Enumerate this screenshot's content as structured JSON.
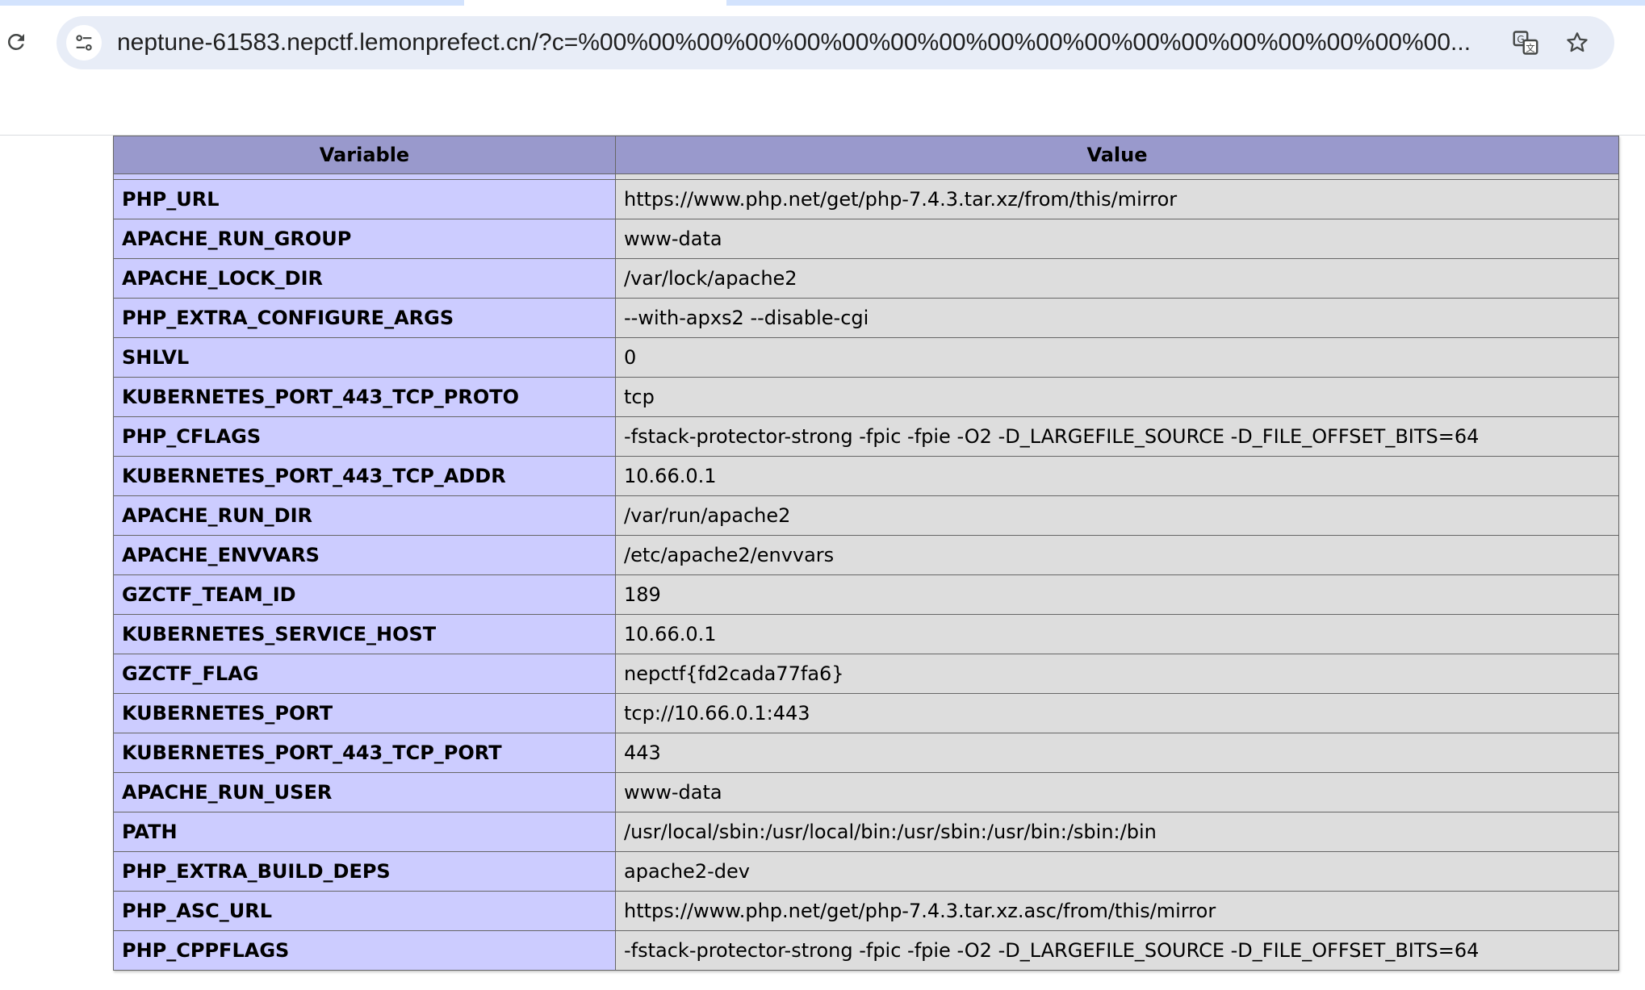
{
  "browser": {
    "url": "neptune-61583.nepctf.lemonprefect.cn/?c=%00%00%00%00%00%00%00%00%00%00%00%00%00%00%00%00%00%00..."
  },
  "table": {
    "headers": [
      "Variable",
      "Value"
    ],
    "rows": [
      {
        "key": "PHP_URL",
        "value": "https://www.php.net/get/php-7.4.3.tar.xz/from/this/mirror"
      },
      {
        "key": "APACHE_RUN_GROUP",
        "value": "www-data"
      },
      {
        "key": "APACHE_LOCK_DIR",
        "value": "/var/lock/apache2"
      },
      {
        "key": "PHP_EXTRA_CONFIGURE_ARGS",
        "value": "--with-apxs2 --disable-cgi"
      },
      {
        "key": "SHLVL",
        "value": "0"
      },
      {
        "key": "KUBERNETES_PORT_443_TCP_PROTO",
        "value": "tcp"
      },
      {
        "key": "PHP_CFLAGS",
        "value": "-fstack-protector-strong -fpic -fpie -O2 -D_LARGEFILE_SOURCE -D_FILE_OFFSET_BITS=64"
      },
      {
        "key": "KUBERNETES_PORT_443_TCP_ADDR",
        "value": "10.66.0.1"
      },
      {
        "key": "APACHE_RUN_DIR",
        "value": "/var/run/apache2"
      },
      {
        "key": "APACHE_ENVVARS",
        "value": "/etc/apache2/envvars"
      },
      {
        "key": "GZCTF_TEAM_ID",
        "value": "189"
      },
      {
        "key": "KUBERNETES_SERVICE_HOST",
        "value": "10.66.0.1"
      },
      {
        "key": "GZCTF_FLAG",
        "value": "nepctf{fd2cada77fa6}"
      },
      {
        "key": "KUBERNETES_PORT",
        "value": "tcp://10.66.0.1:443"
      },
      {
        "key": "KUBERNETES_PORT_443_TCP_PORT",
        "value": "443"
      },
      {
        "key": "APACHE_RUN_USER",
        "value": "www-data"
      },
      {
        "key": "PATH",
        "value": "/usr/local/sbin:/usr/local/bin:/usr/sbin:/usr/bin:/sbin:/bin"
      },
      {
        "key": "PHP_EXTRA_BUILD_DEPS",
        "value": "apache2-dev"
      },
      {
        "key": "PHP_ASC_URL",
        "value": "https://www.php.net/get/php-7.4.3.tar.xz.asc/from/this/mirror"
      },
      {
        "key": "PHP_CPPFLAGS",
        "value": "-fstack-protector-strong -fpic -fpie -O2 -D_LARGEFILE_SOURCE -D_FILE_OFFSET_BITS=64"
      }
    ]
  },
  "colors": {
    "header_bg": "#9999cc",
    "key_bg": "#ccccff",
    "value_bg": "#dddddd",
    "omnibox_bg": "#e8edf7"
  },
  "icons": [
    "reload-icon",
    "site-settings-icon",
    "translate-icon",
    "bookmark-star-icon"
  ]
}
